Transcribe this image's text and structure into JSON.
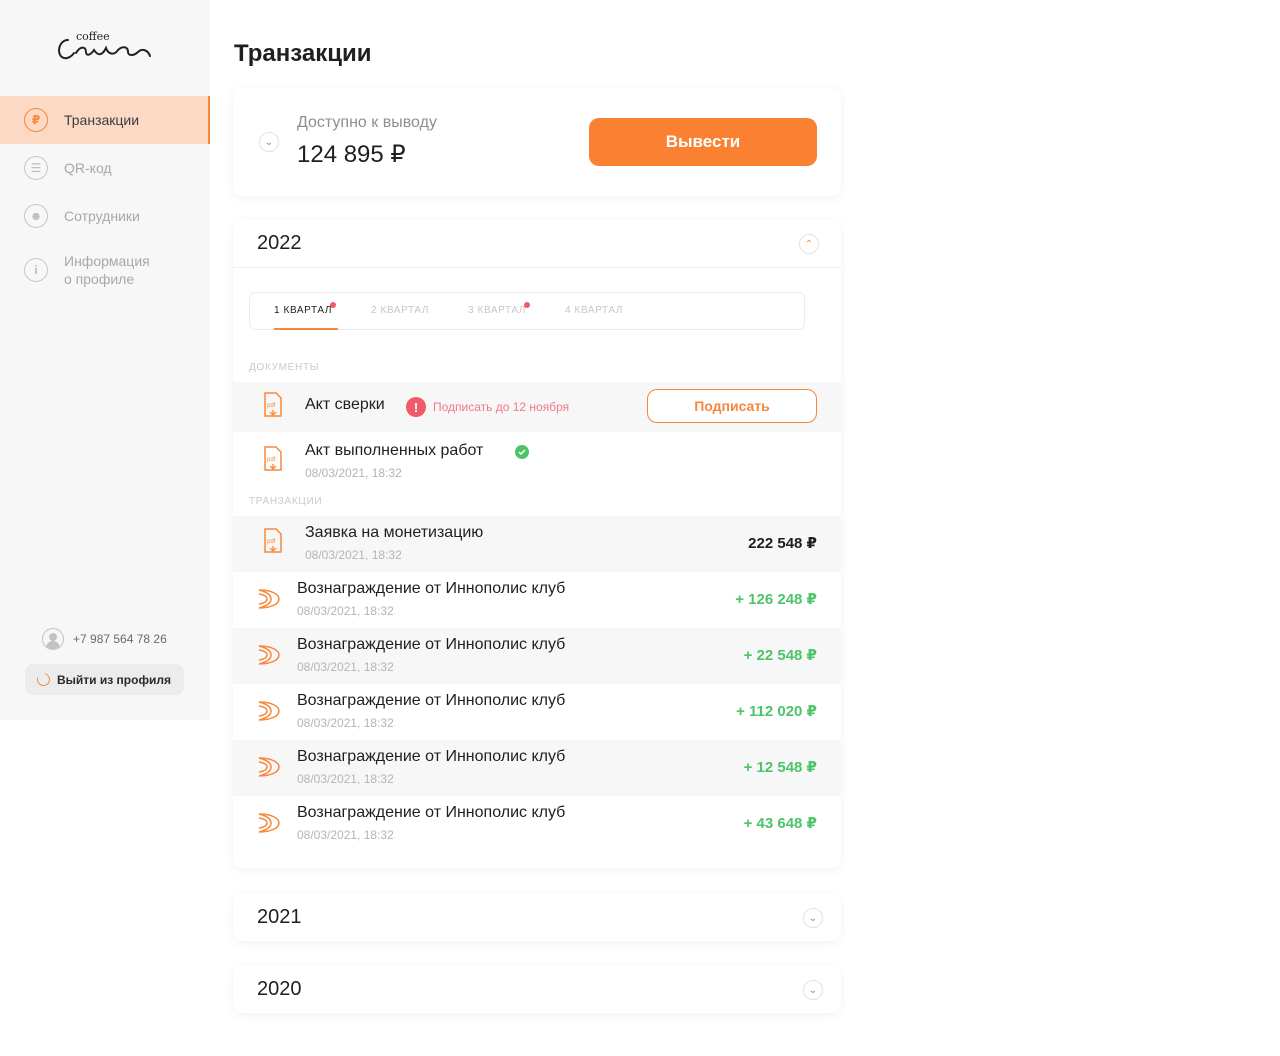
{
  "brand": {
    "small": "coffee",
    "name": "Cava"
  },
  "sidebar": {
    "items": [
      {
        "label": "Транзакции",
        "icon": "ruble-icon",
        "glyph": "₽",
        "active": true
      },
      {
        "label": "QR-код",
        "icon": "qr-icon",
        "glyph": "☰"
      },
      {
        "label": "Сотрудники",
        "icon": "users-icon",
        "glyph": "☻"
      },
      {
        "label": "Информация\nо профиле",
        "line1": "Информация",
        "line2": "о профиле",
        "icon": "info-icon",
        "glyph": "i"
      }
    ],
    "phone": "+7 987 564 78 26",
    "logout_label": "Выйти из профиля"
  },
  "page": {
    "title": "Транзакции"
  },
  "balance": {
    "label": "Доступно к выводу",
    "amount": "124 895 ₽",
    "withdraw_label": "Вывести"
  },
  "years": [
    {
      "year": "2022",
      "expanded": true,
      "tabs": [
        {
          "label": "1 КВАРТАЛ",
          "active": true,
          "alert": true
        },
        {
          "label": "2 КВАРТАЛ",
          "active": false,
          "alert": false
        },
        {
          "label": "3 КВАРТАЛ",
          "active": false,
          "alert": true
        },
        {
          "label": "4 КВАРТАЛ",
          "active": false,
          "alert": false
        }
      ],
      "documents_label": "ДОКУМЕНТЫ",
      "documents": [
        {
          "title": "Акт сверки",
          "warning": "Подписать до 12 ноября",
          "action": "Подписать"
        },
        {
          "title": "Акт выполненных работ",
          "date": "08/03/2021, 18:32",
          "status": "signed"
        }
      ],
      "transactions_label": "ТРАНЗАКЦИИ",
      "transactions": [
        {
          "title": "Заявка на монетизацию",
          "date": "08/03/2021, 18:32",
          "amount": "222 548 ₽",
          "type": "request"
        },
        {
          "title": "Вознаграждение от Иннополис клуб",
          "date": "08/03/2021, 18:32",
          "amount": "+ 126 248 ₽",
          "type": "reward"
        },
        {
          "title": "Вознаграждение от Иннополис клуб",
          "date": "08/03/2021, 18:32",
          "amount": "+ 22 548 ₽",
          "type": "reward"
        },
        {
          "title": "Вознаграждение от Иннополис клуб",
          "date": "08/03/2021, 18:32",
          "amount": "+ 112 020 ₽",
          "type": "reward"
        },
        {
          "title": "Вознаграждение от Иннополис клуб",
          "date": "08/03/2021, 18:32",
          "amount": "+ 12 548 ₽",
          "type": "reward"
        },
        {
          "title": "Вознаграждение от Иннополис клуб",
          "date": "08/03/2021, 18:32",
          "amount": "+ 43 648 ₽",
          "type": "reward"
        }
      ]
    },
    {
      "year": "2021",
      "expanded": false
    },
    {
      "year": "2020",
      "expanded": false
    }
  ],
  "colors": {
    "accent": "#fb8132",
    "positive": "#4cc468",
    "alert": "#f05a6a",
    "active_bg": "#fcd9c4"
  }
}
